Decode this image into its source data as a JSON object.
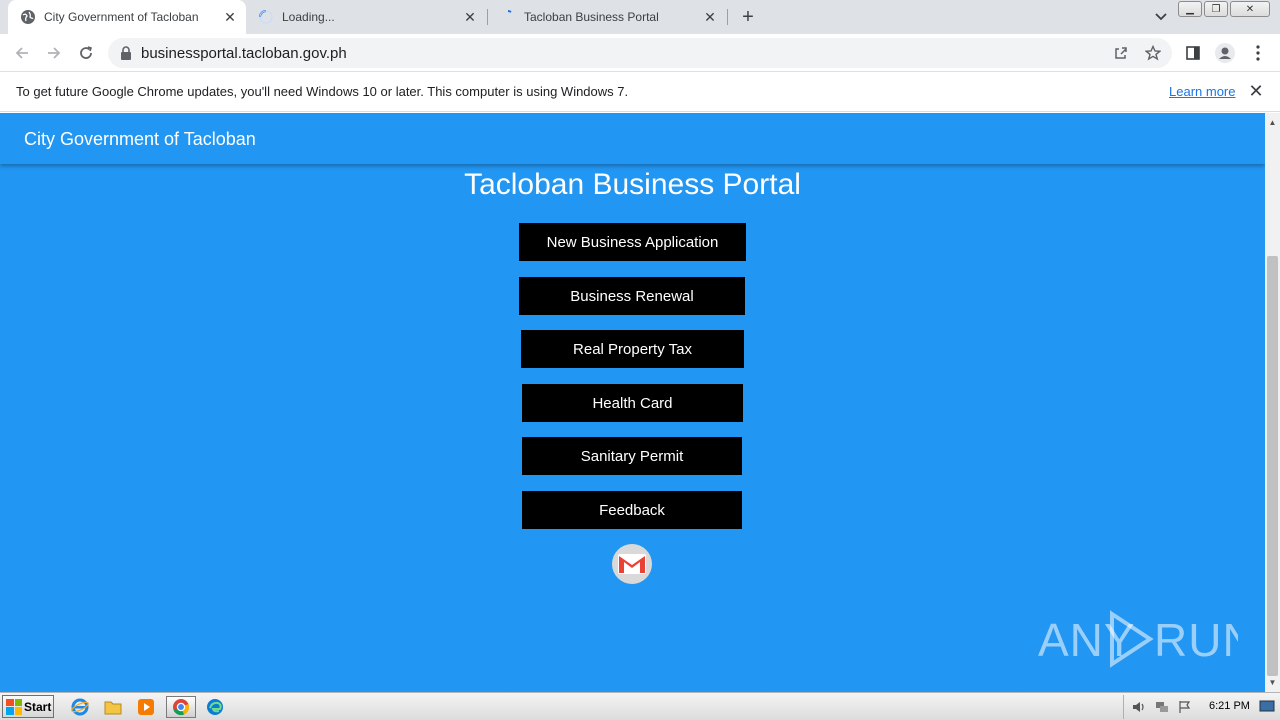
{
  "browser": {
    "tabs": [
      {
        "title": "City Government of Tacloban",
        "active": true,
        "icon": "globe-icon"
      },
      {
        "title": "Loading...",
        "active": false,
        "icon": "loading-spinner-icon"
      },
      {
        "title": "Tacloban Business Portal",
        "active": false,
        "icon": "loading-spinner-icon"
      }
    ],
    "url": "businessportal.tacloban.gov.ph",
    "infobar": {
      "message": "To get future Google Chrome updates, you'll need Windows 10 or later. This computer is using Windows 7.",
      "link": "Learn more"
    }
  },
  "page": {
    "appbar_title": "City Government of Tacloban",
    "portal_title": "Tacloban Business Portal",
    "menu": [
      {
        "label": "New Business Application"
      },
      {
        "label": "Business Renewal"
      },
      {
        "label": "Real Property Tax"
      },
      {
        "label": "Health Card"
      },
      {
        "label": "Sanitary Permit"
      },
      {
        "label": "Feedback"
      }
    ],
    "contact_icon": "gmail-icon",
    "watermark": "ANY RUN"
  },
  "taskbar": {
    "start_label": "Start",
    "clock": "6:21 PM",
    "apps": [
      "ie-icon",
      "explorer-icon",
      "media-player-icon",
      "chrome-icon",
      "edge-icon"
    ]
  },
  "colors": {
    "page_bg": "#2196f3",
    "button_bg": "#000000",
    "button_text": "#ffffff"
  }
}
